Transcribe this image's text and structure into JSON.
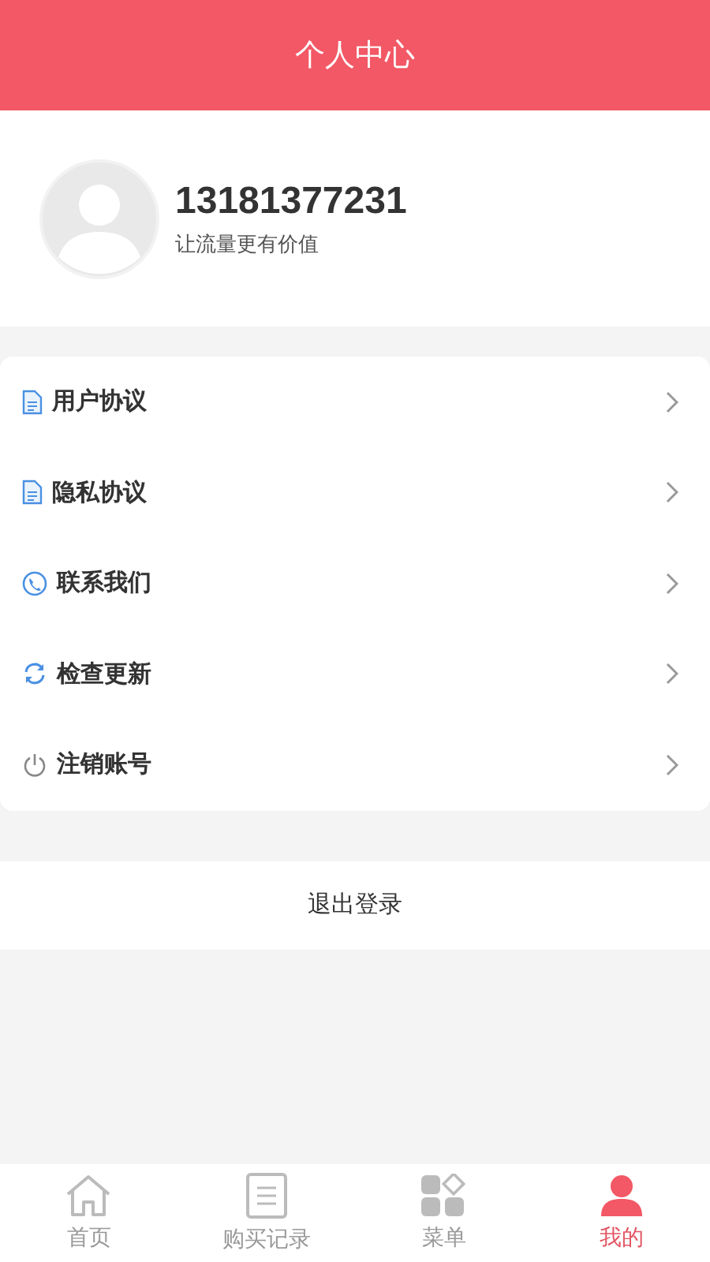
{
  "header": {
    "title": "个人中心"
  },
  "profile": {
    "phone": "13181377231",
    "slogan": "让流量更有价值"
  },
  "menu": [
    {
      "kind": "document",
      "label": "用户协议"
    },
    {
      "kind": "document",
      "label": "隐私协议"
    },
    {
      "kind": "phone",
      "label": "联系我们"
    },
    {
      "kind": "refresh",
      "label": "检查更新"
    },
    {
      "kind": "power",
      "label": "注销账号"
    }
  ],
  "logout": {
    "label": "退出登录"
  },
  "tabs": [
    {
      "kind": "home",
      "label": "首页",
      "selected": false
    },
    {
      "kind": "list",
      "label": "购买记录",
      "selected": false
    },
    {
      "kind": "grid",
      "label": "菜单",
      "selected": false
    },
    {
      "kind": "user",
      "label": "我的",
      "selected": true
    }
  ]
}
